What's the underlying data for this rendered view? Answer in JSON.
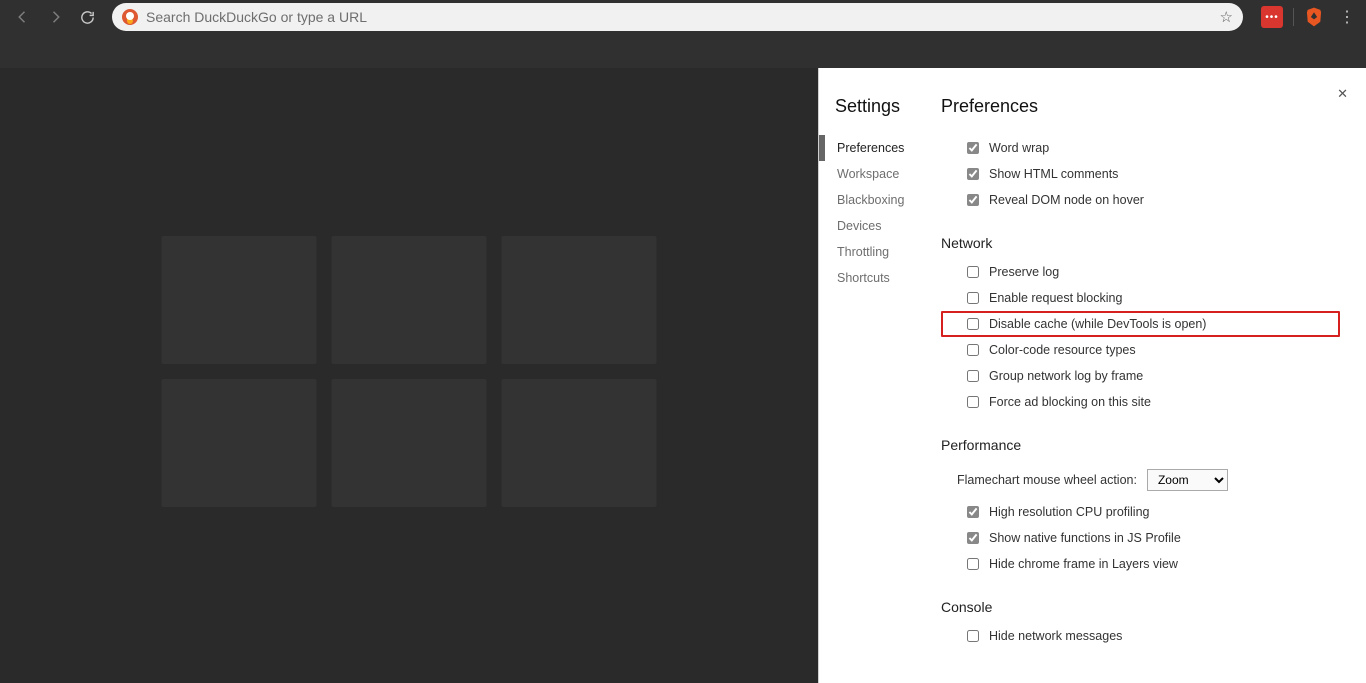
{
  "toolbar": {
    "omnibox_placeholder": "Search DuckDuckGo or type a URL"
  },
  "devtools": {
    "sidebar_title": "Settings",
    "panel_title": "Preferences",
    "sidebar_items": [
      {
        "label": "Preferences",
        "selected": true
      },
      {
        "label": "Workspace",
        "selected": false
      },
      {
        "label": "Blackboxing",
        "selected": false
      },
      {
        "label": "Devices",
        "selected": false
      },
      {
        "label": "Throttling",
        "selected": false
      },
      {
        "label": "Shortcuts",
        "selected": false
      }
    ],
    "top_prefs": [
      {
        "label": "Word wrap",
        "checked": true
      },
      {
        "label": "Show HTML comments",
        "checked": true
      },
      {
        "label": "Reveal DOM node on hover",
        "checked": true
      }
    ],
    "sections": [
      {
        "title": "Network",
        "items": [
          {
            "label": "Preserve log",
            "checked": false,
            "highlighted": false
          },
          {
            "label": "Enable request blocking",
            "checked": false,
            "highlighted": false
          },
          {
            "label": "Disable cache (while DevTools is open)",
            "checked": false,
            "highlighted": true
          },
          {
            "label": "Color-code resource types",
            "checked": false,
            "highlighted": false
          },
          {
            "label": "Group network log by frame",
            "checked": false,
            "highlighted": false
          },
          {
            "label": "Force ad blocking on this site",
            "checked": false,
            "highlighted": false
          }
        ]
      },
      {
        "title": "Performance",
        "select": {
          "label": "Flamechart mouse wheel action:",
          "value": "Zoom"
        },
        "items": [
          {
            "label": "High resolution CPU profiling",
            "checked": true,
            "highlighted": false
          },
          {
            "label": "Show native functions in JS Profile",
            "checked": true,
            "highlighted": false
          },
          {
            "label": "Hide chrome frame in Layers view",
            "checked": false,
            "highlighted": false
          }
        ]
      },
      {
        "title": "Console",
        "items": [
          {
            "label": "Hide network messages",
            "checked": false,
            "highlighted": false
          }
        ]
      }
    ]
  }
}
